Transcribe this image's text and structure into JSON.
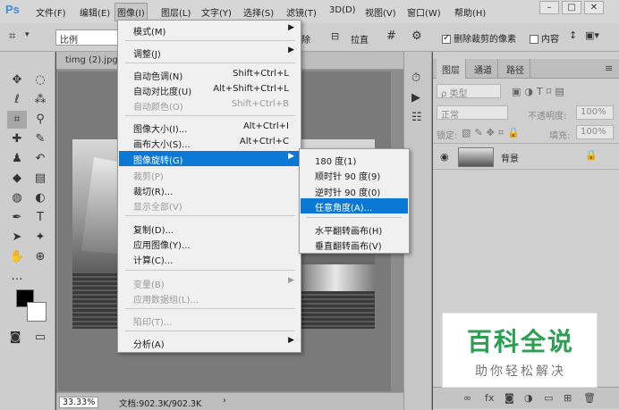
{
  "app": {
    "logo": "Ps"
  },
  "menubar": {
    "items": [
      "文件(F)",
      "编辑(E)",
      "图像(I)",
      "图层(L)",
      "文字(Y)",
      "选择(S)",
      "滤镜(T)",
      "3D(D)",
      "视图(V)",
      "窗口(W)",
      "帮助(H)"
    ],
    "active_index": 2
  },
  "window_controls": {
    "minimize": "–",
    "maximize": "□",
    "close": "✕"
  },
  "options_bar": {
    "ratio_label": "比例",
    "clear_label": "除",
    "straighten_label": "拉直",
    "delete_cropped_label": "删除裁剪的像素",
    "content_aware_label": "内容"
  },
  "document": {
    "tab_title": "timg (2).jpg",
    "zoom": "33.33%",
    "doc_info": "文档:902.3K/902.3K",
    "status_arrow": "›"
  },
  "image_menu": {
    "items": [
      {
        "label": "模式(M)",
        "shortcut": "",
        "submenu": true,
        "disabled": false
      },
      {
        "sep": true
      },
      {
        "label": "调整(J)",
        "shortcut": "",
        "submenu": true,
        "disabled": false
      },
      {
        "sep": true
      },
      {
        "label": "自动色调(N)",
        "shortcut": "Shift+Ctrl+L",
        "submenu": false,
        "disabled": false
      },
      {
        "label": "自动对比度(U)",
        "shortcut": "Alt+Shift+Ctrl+L",
        "submenu": false,
        "disabled": false
      },
      {
        "label": "自动颜色(O)",
        "shortcut": "Shift+Ctrl+B",
        "submenu": false,
        "disabled": true
      },
      {
        "sep": true
      },
      {
        "label": "图像大小(I)...",
        "shortcut": "Alt+Ctrl+I",
        "submenu": false,
        "disabled": false
      },
      {
        "label": "画布大小(S)...",
        "shortcut": "Alt+Ctrl+C",
        "submenu": false,
        "disabled": false
      },
      {
        "label": "图像旋转(G)",
        "shortcut": "",
        "submenu": true,
        "disabled": false,
        "highlight": true
      },
      {
        "label": "裁剪(P)",
        "shortcut": "",
        "submenu": false,
        "disabled": true
      },
      {
        "label": "裁切(R)...",
        "shortcut": "",
        "submenu": false,
        "disabled": false
      },
      {
        "label": "显示全部(V)",
        "shortcut": "",
        "submenu": false,
        "disabled": true
      },
      {
        "sep": true
      },
      {
        "label": "复制(D)...",
        "shortcut": "",
        "submenu": false,
        "disabled": false
      },
      {
        "label": "应用图像(Y)...",
        "shortcut": "",
        "submenu": false,
        "disabled": false
      },
      {
        "label": "计算(C)...",
        "shortcut": "",
        "submenu": false,
        "disabled": false
      },
      {
        "sep": true
      },
      {
        "label": "变量(B)",
        "shortcut": "",
        "submenu": true,
        "disabled": true
      },
      {
        "label": "应用数据组(L)...",
        "shortcut": "",
        "submenu": false,
        "disabled": true
      },
      {
        "sep": true
      },
      {
        "label": "陷印(T)...",
        "shortcut": "",
        "submenu": false,
        "disabled": true
      },
      {
        "sep": true
      },
      {
        "label": "分析(A)",
        "shortcut": "",
        "submenu": true,
        "disabled": false
      }
    ]
  },
  "rotate_submenu": {
    "items": [
      {
        "label": "180 度(1)"
      },
      {
        "label": "顺时针 90 度(9)"
      },
      {
        "label": "逆时针 90 度(0)"
      },
      {
        "label": "任意角度(A)...",
        "highlight": true
      },
      {
        "sep": true
      },
      {
        "label": "水平翻转画布(H)"
      },
      {
        "label": "垂直翻转画布(V)"
      }
    ]
  },
  "layers_panel": {
    "tabs": [
      "图层",
      "通道",
      "路径"
    ],
    "filter_label": "ρ 类型",
    "blend_mode": "正常",
    "opacity_label": "不透明度:",
    "opacity_value": "100%",
    "lock_label": "锁定:",
    "fill_label": "填充:",
    "fill_value": "100%",
    "layer_name": "背景"
  },
  "watermark": {
    "title": "百科全说",
    "subtitle": "助你轻松解决"
  },
  "colors": {
    "highlight": "#0b78d6",
    "brand_green": "#2c9f53"
  }
}
